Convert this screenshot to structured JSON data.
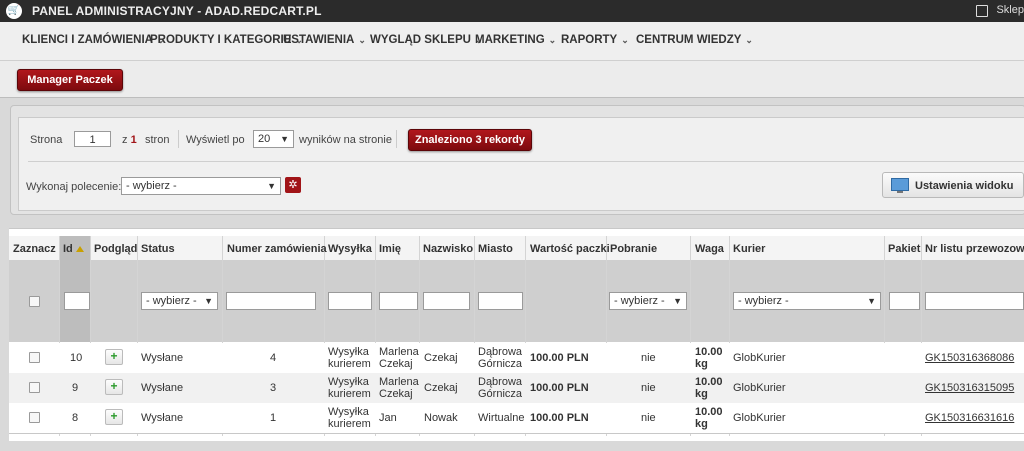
{
  "topbar": {
    "title": "PANEL ADMINISTRACYJNY - ADAD.REDCART.PL",
    "shop_label": "Sklep"
  },
  "menu": [
    {
      "label": "KLIENCI I ZAMÓWIENIA"
    },
    {
      "label": "PRODUKTY I KATEGORIE"
    },
    {
      "label": "USTAWIENIA"
    },
    {
      "label": "WYGLĄD SKLEPU"
    },
    {
      "label": "MARKETING"
    },
    {
      "label": "RAPORTY"
    },
    {
      "label": "CENTRUM WIEDZY"
    }
  ],
  "subbar": {
    "manager_button": "Manager Paczek"
  },
  "pager": {
    "page_label": "Strona",
    "page_value": "1",
    "of_label": "z",
    "of_value": "1",
    "pages_label": "stron",
    "show_label": "Wyświetl po",
    "per_page_value": "20",
    "results_label": "wyników na stronie",
    "found_badge": "Znaleziono 3 rekordy"
  },
  "command": {
    "label": "Wykonaj polecenie:",
    "select_value": "- wybierz -"
  },
  "view_settings": {
    "label": "Ustawienia widoku"
  },
  "table": {
    "headers": {
      "select": "Zaznacz",
      "id": "Id",
      "preview": "Podgląd",
      "status": "Status",
      "order_no": "Numer zamówienia",
      "shipping": "Wysyłka",
      "first_name": "Imię",
      "last_name": "Nazwisko",
      "city": "Miasto",
      "value": "Wartość paczki",
      "cod": "Pobranie",
      "weight": "Waga",
      "courier": "Kurier",
      "package": "Pakiet",
      "tracking": "Nr listu przewozow"
    },
    "filters": {
      "status": "- wybierz -",
      "cod": "- wybierz -",
      "courier": "- wybierz -"
    },
    "rows": [
      {
        "id": "10",
        "status": "Wysłane",
        "order_no": "4",
        "ship1": "Wysyłka",
        "ship2": "kurierem",
        "fn1": "Marlena",
        "fn2": "Czekaj",
        "ln": "Czekaj",
        "city1": "Dąbrowa",
        "city2": "Górnicza",
        "value": "100.00 PLN",
        "cod": "nie",
        "w1": "10.00",
        "w2": "kg",
        "courier": "GlobKurier",
        "tracking": "GK150316368086"
      },
      {
        "id": "9",
        "status": "Wysłane",
        "order_no": "3",
        "ship1": "Wysyłka",
        "ship2": "kurierem",
        "fn1": "Marlena",
        "fn2": "Czekaj",
        "ln": "Czekaj",
        "city1": "Dąbrowa",
        "city2": "Górnicza",
        "value": "100.00 PLN",
        "cod": "nie",
        "w1": "10.00",
        "w2": "kg",
        "courier": "GlobKurier",
        "tracking": "GK150316315095"
      },
      {
        "id": "8",
        "status": "Wysłane",
        "order_no": "1",
        "ship1": "Wysyłka",
        "ship2": "kurierem",
        "fn1": "Jan",
        "fn2": "",
        "ln": "Nowak",
        "city1": "Wirtualne",
        "city2": "",
        "value": "100.00 PLN",
        "cod": "nie",
        "w1": "10.00",
        "w2": "kg",
        "courier": "GlobKurier",
        "tracking": "GK150316631616"
      }
    ]
  }
}
